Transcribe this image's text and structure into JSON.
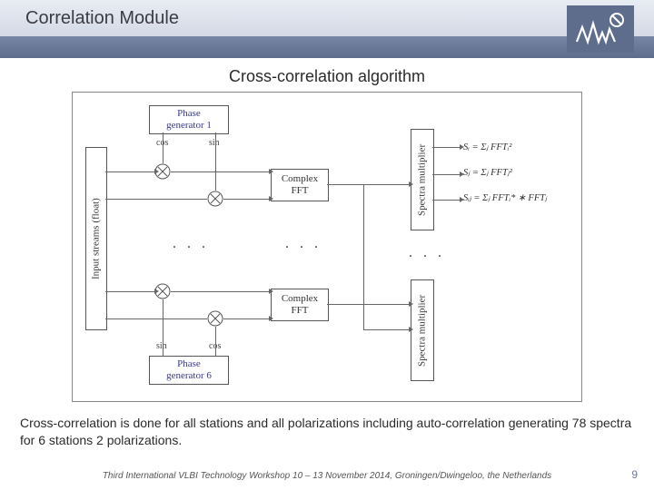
{
  "header": {
    "title": "Correlation Module"
  },
  "subtitle": "Cross-correlation algorithm",
  "diagram": {
    "input_block": "Input streams (float)",
    "phase_gen_1": "Phase\ngenerator 1",
    "phase_gen_6": "Phase\ngenerator 6",
    "cos": "cos",
    "sin": "sin",
    "complex_fft_1": "Complex\nFFT",
    "complex_fft_2": "Complex\nFFT",
    "spectra_mult_1": "Spectra\nmultiplier",
    "spectra_mult_2": "Spectra\nmultiplier",
    "dots": ". . .",
    "eq1": "Sᵢ = Σⱼ FFTᵢ²",
    "eq2": "Sⱼ = Σⱼ FFTⱼ²",
    "eq3": "Sᵢⱼ = Σⱼ FFTᵢ* ∗ FFTⱼ"
  },
  "caption": "Cross-correlation is done for  all  stations  and  all polarizations  including auto-correlation generating 78 spectra for 6 stations 2 polarizations.",
  "footer": "Third International VLBI Technology Workshop 10 – 13 November 2014, Groningen/Dwingeloo, the Netherlands",
  "page_number": "9"
}
